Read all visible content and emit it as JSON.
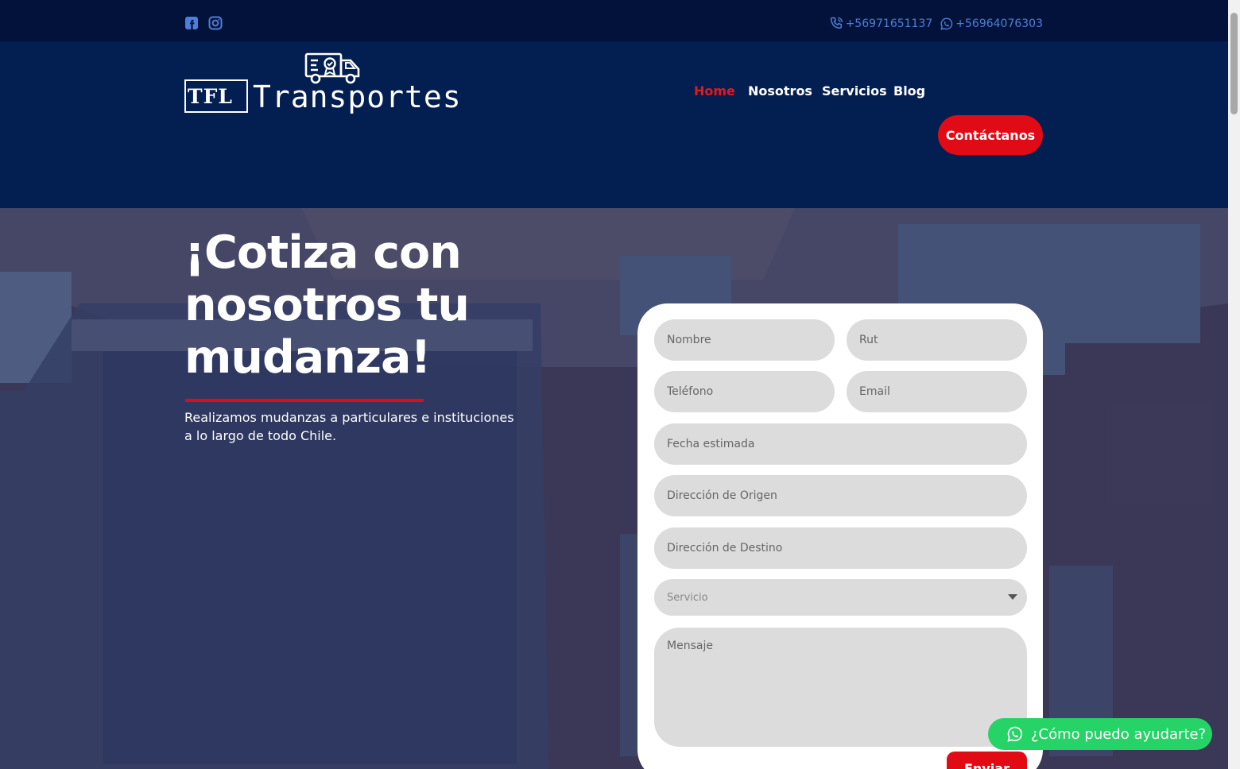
{
  "topbar": {
    "social": [
      "facebook-icon",
      "instagram-icon"
    ],
    "phone": "+56971651137",
    "whatsapp": "+56964076303"
  },
  "header": {
    "logo_box_text": "TFL",
    "logo_text": "Transportes",
    "nav": [
      {
        "label": "Home",
        "active": true
      },
      {
        "label": "Nosotros",
        "active": false
      },
      {
        "label": "Servicios",
        "active": false
      },
      {
        "label": "Blog",
        "active": false
      }
    ],
    "cta_label": "Contáctanos"
  },
  "hero": {
    "title": "¡Cotiza con nosotros tu mudanza!",
    "subtitle": "Realizamos mudanzas a particulares e instituciones a lo largo de todo Chile."
  },
  "form": {
    "nombre": "Nombre",
    "rut": "Rut",
    "telefono": "Teléfono",
    "email": "Email",
    "fecha": "Fecha estimada",
    "origen": "Dirección de Origen",
    "destino": "Dirección de Destino",
    "servicio": "Servicio",
    "mensaje": "Mensaje",
    "submit": "Enviar"
  },
  "whatsapp_widget": {
    "label": "¿Cómo puedo ayudarte?"
  },
  "colors": {
    "topbar": "#03123a",
    "header": "#031e50",
    "accent_red": "#e10b16",
    "whatsapp_green": "#25d366",
    "link_blue": "#4f7fd8"
  }
}
